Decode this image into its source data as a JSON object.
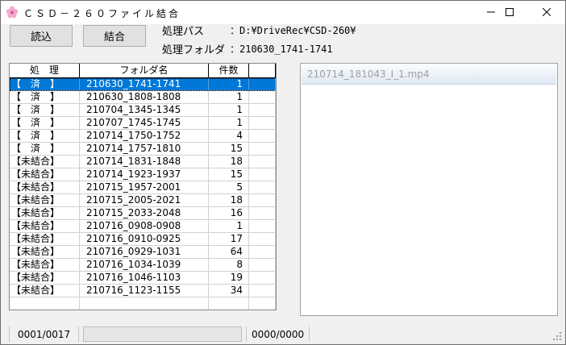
{
  "window": {
    "title": "ＣＳＤ－２６０ファイル結合"
  },
  "toolbar": {
    "read_label": "読込",
    "join_label": "結合"
  },
  "info": {
    "path_label": "処理パス",
    "path_value": "：D:¥DriveRec¥CSD-260¥",
    "folder_label": "処理フォルダ",
    "folder_value": "：210630_1741-1741"
  },
  "table": {
    "headers": [
      "処　理",
      "フォルダ名",
      "件数"
    ],
    "rows": [
      {
        "status": "【　済　】",
        "folder": "210630_1741-1741",
        "count": "1",
        "selected": true
      },
      {
        "status": "【　済　】",
        "folder": "210630_1808-1808",
        "count": "1"
      },
      {
        "status": "【　済　】",
        "folder": "210704_1345-1345",
        "count": "1"
      },
      {
        "status": "【　済　】",
        "folder": "210707_1745-1745",
        "count": "1"
      },
      {
        "status": "【　済　】",
        "folder": "210714_1750-1752",
        "count": "4"
      },
      {
        "status": "【　済　】",
        "folder": "210714_1757-1810",
        "count": "15"
      },
      {
        "status": "【未結合】",
        "folder": "210714_1831-1848",
        "count": "18"
      },
      {
        "status": "【未結合】",
        "folder": "210714_1923-1937",
        "count": "15"
      },
      {
        "status": "【未結合】",
        "folder": "210715_1957-2001",
        "count": "5"
      },
      {
        "status": "【未結合】",
        "folder": "210715_2005-2021",
        "count": "18"
      },
      {
        "status": "【未結合】",
        "folder": "210715_2033-2048",
        "count": "16"
      },
      {
        "status": "【未結合】",
        "folder": "210716_0908-0908",
        "count": "1"
      },
      {
        "status": "【未結合】",
        "folder": "210716_0910-0925",
        "count": "17"
      },
      {
        "status": "【未結合】",
        "folder": "210716_0929-1031",
        "count": "64"
      },
      {
        "status": "【未結合】",
        "folder": "210716_1034-1039",
        "count": "8"
      },
      {
        "status": "【未結合】",
        "folder": "210716_1046-1103",
        "count": "19"
      },
      {
        "status": "【未結合】",
        "folder": "210716_1123-1155",
        "count": "34"
      },
      {
        "status": "",
        "folder": "",
        "count": ""
      }
    ]
  },
  "preview": {
    "title": "210714_181043_I_1.mp4"
  },
  "status": {
    "folder_counter": "0001/0017",
    "file_counter": "0000/0000",
    "progress": 0
  },
  "icons": {
    "app": "flower-icon",
    "minimize": "minimize-icon",
    "maximize": "maximize-icon",
    "close": "close-icon",
    "grip": "resize-grip-icon"
  },
  "colors": {
    "selection": "#0078d7",
    "title_bg": "#ffffff",
    "app_icon": "#e8a0c8"
  }
}
